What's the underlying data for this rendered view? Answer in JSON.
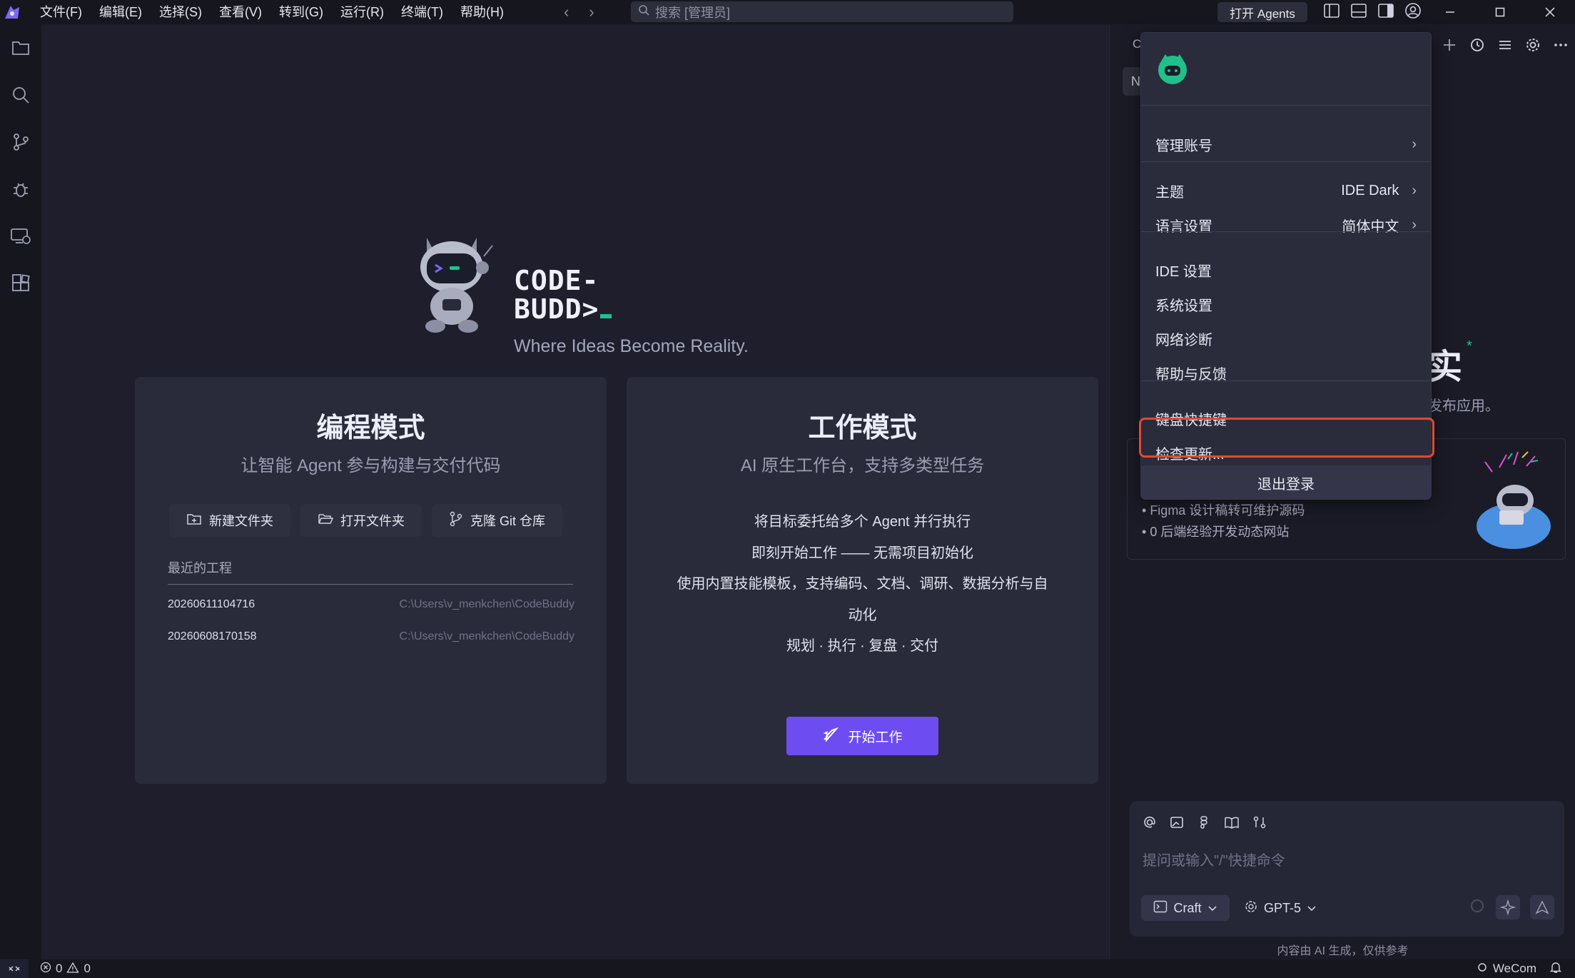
{
  "titlebar": {
    "menus": [
      "文件(F)",
      "编辑(E)",
      "选择(S)",
      "查看(V)",
      "转到(G)",
      "运行(R)",
      "终端(T)",
      "帮助(H)"
    ],
    "search_placeholder": "搜索 [管理员]",
    "open_agents": "打开 Agents",
    "accent": "#6d4cf2"
  },
  "hero": {
    "brand_line1": "CODE-",
    "brand_line2": "BUDD>",
    "tagline": "Where Ideas Become Reality."
  },
  "code_card": {
    "title": "编程模式",
    "subtitle": "让智能 Agent 参与构建与交付代码",
    "buttons": [
      "新建文件夹",
      "打开文件夹",
      "克隆 Git 仓库"
    ],
    "recent_title": "最近的工程",
    "recent": [
      {
        "name": "20260611104716",
        "path": "C:\\Users\\v_menkchen\\CodeBuddy"
      },
      {
        "name": "20260608170158",
        "path": "C:\\Users\\v_menkchen\\CodeBuddy"
      }
    ]
  },
  "work_card": {
    "title": "工作模式",
    "subtitle": "AI 原生工作台，支持多类型任务",
    "lines": [
      "将目标委托给多个 Agent 并行执行",
      "即刻开始工作 —— 无需项目初始化",
      "使用内置技能模板，支持编码、文档、调研、数据分析与自",
      "动化",
      "规划 · 执行 · 复盘 · 交付"
    ],
    "start_button": "开始工作"
  },
  "right_panel": {
    "tab_partial": "C",
    "tab2_partial": "N",
    "hero_char": "实",
    "hero_sub": "发布应用。",
    "promo_bullets": [
      "Figma 设计稿转可维护源码",
      "0 后端经验开发动态网站"
    ],
    "chat_placeholder": "提问或输入\"/\"快捷命令",
    "mode": "Craft",
    "model": "GPT-5",
    "disclaimer": "内容由 AI 生成，仅供参考"
  },
  "dropdown": {
    "items": [
      {
        "label": "管理账号",
        "value": ""
      },
      {
        "label": "主题",
        "value": "IDE Dark"
      },
      {
        "label": "语言设置",
        "value": "简体中文"
      },
      {
        "label": "IDE 设置",
        "value": ""
      },
      {
        "label": "系统设置",
        "value": ""
      },
      {
        "label": "网络诊断",
        "value": ""
      },
      {
        "label": "帮助与反馈",
        "value": ""
      },
      {
        "label": "键盘快捷键",
        "value": ""
      },
      {
        "label": "检查更新...",
        "value": ""
      }
    ],
    "logout": "退出登录",
    "highlight_color": "#e04a32"
  },
  "statusbar": {
    "errors": "0",
    "warnings": "0",
    "wecom": "WeCom"
  }
}
